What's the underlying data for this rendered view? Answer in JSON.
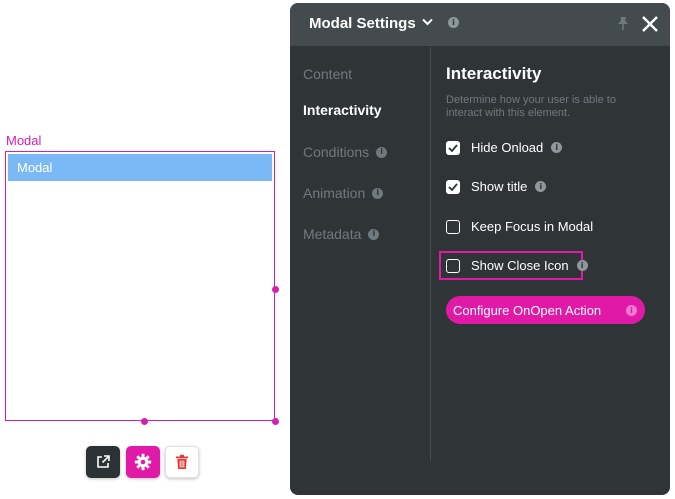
{
  "canvas": {
    "modal_tag": "Modal",
    "modal_header": "Modal",
    "toolbar": {
      "open_icon": "external-link-icon",
      "settings_icon": "gear-icon",
      "delete_icon": "trash-icon"
    }
  },
  "panel": {
    "title": "Modal Settings",
    "nav": [
      {
        "label": "Content",
        "active": false
      },
      {
        "label": "Interactivity",
        "active": true
      },
      {
        "label": "Conditions",
        "active": false
      },
      {
        "label": "Animation",
        "active": false
      },
      {
        "label": "Metadata",
        "active": false
      }
    ],
    "section_title": "Interactivity",
    "section_desc": "Determine how your user is able to interact with this element.",
    "options": [
      {
        "label": "Hide Onload",
        "checked": true
      },
      {
        "label": "Show title",
        "checked": true
      },
      {
        "label": "Keep Focus in Modal",
        "checked": false
      },
      {
        "label": "Show Close Icon",
        "checked": false
      }
    ],
    "action_button": "Configure OnOpen Action"
  },
  "colors": {
    "accent": "#e01aa6",
    "panel_bg": "#2f3537",
    "header_bg": "#434b4e",
    "modal_header": "#7ab9f5"
  }
}
